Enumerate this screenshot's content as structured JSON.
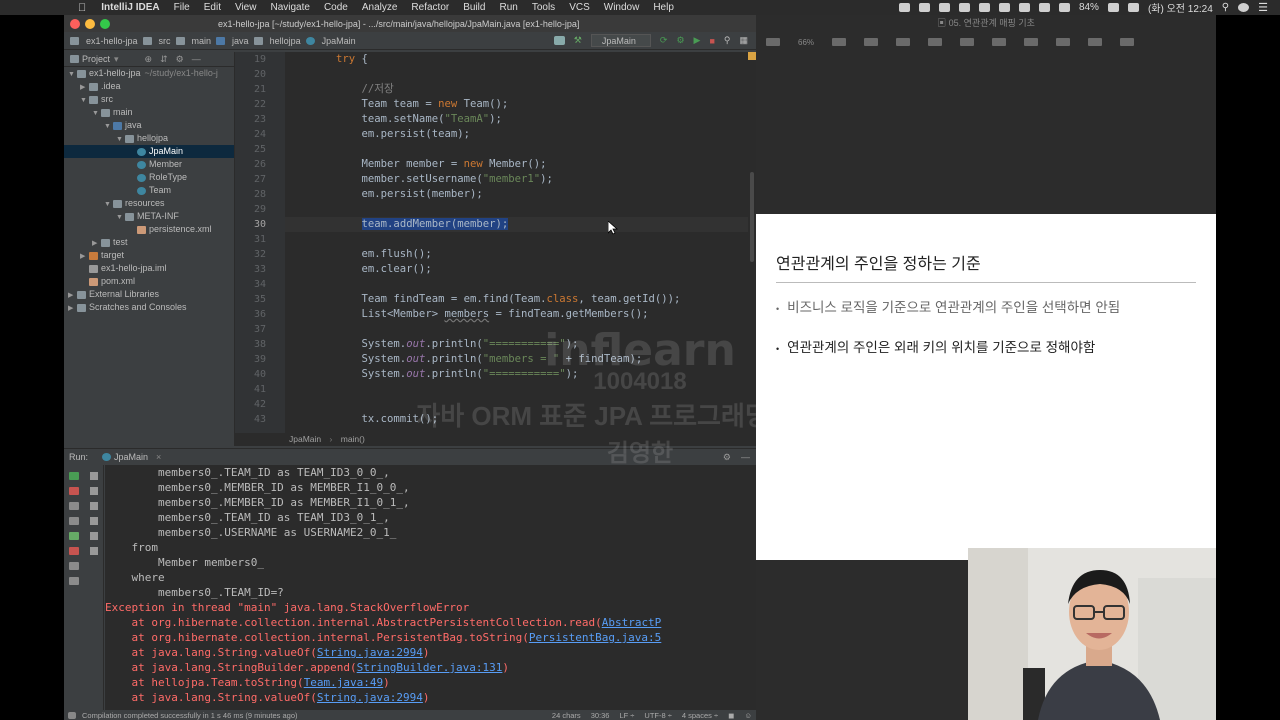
{
  "menubar": {
    "app": "IntelliJ IDEA",
    "items": [
      "File",
      "Edit",
      "View",
      "Navigate",
      "Code",
      "Analyze",
      "Refactor",
      "Build",
      "Run",
      "Tools",
      "VCS",
      "Window",
      "Help"
    ],
    "battery": "84%",
    "datetime": "(화) 오전 12:24"
  },
  "ide": {
    "window_title": "ex1-hello-jpa [~/study/ex1-hello-jpa] - .../src/main/java/hellojpa/JpaMain.java [ex1-hello-jpa]",
    "breadcrumbs": [
      "ex1-hello-jpa",
      "src",
      "main",
      "java",
      "hellojpa",
      "JpaMain"
    ],
    "run_config": "JpaMain",
    "project_panel": {
      "header": "Project",
      "tree": [
        {
          "label": "ex1-hello-jpa",
          "suffix": "~/study/ex1-hello-j",
          "depth": 0,
          "arrow": "▼",
          "icon": "folder"
        },
        {
          "label": ".idea",
          "depth": 1,
          "arrow": "▶",
          "icon": "folder"
        },
        {
          "label": "src",
          "depth": 1,
          "arrow": "▼",
          "icon": "folder"
        },
        {
          "label": "main",
          "depth": 2,
          "arrow": "▼",
          "icon": "folder"
        },
        {
          "label": "java",
          "depth": 3,
          "arrow": "▼",
          "icon": "src"
        },
        {
          "label": "hellojpa",
          "depth": 4,
          "arrow": "▼",
          "icon": "folder"
        },
        {
          "label": "JpaMain",
          "depth": 5,
          "arrow": "",
          "icon": "cls",
          "selected": true
        },
        {
          "label": "Member",
          "depth": 5,
          "arrow": "",
          "icon": "cls"
        },
        {
          "label": "RoleType",
          "depth": 5,
          "arrow": "",
          "icon": "cls"
        },
        {
          "label": "Team",
          "depth": 5,
          "arrow": "",
          "icon": "cls"
        },
        {
          "label": "resources",
          "depth": 3,
          "arrow": "▼",
          "icon": "folder"
        },
        {
          "label": "META-INF",
          "depth": 4,
          "arrow": "▼",
          "icon": "folder"
        },
        {
          "label": "persistence.xml",
          "depth": 5,
          "arrow": "",
          "icon": "xml"
        },
        {
          "label": "test",
          "depth": 2,
          "arrow": "▶",
          "icon": "folder"
        },
        {
          "label": "target",
          "depth": 1,
          "arrow": "▶",
          "icon": "orange"
        },
        {
          "label": "ex1-hello-jpa.iml",
          "depth": 1,
          "arrow": "",
          "icon": "file"
        },
        {
          "label": "pom.xml",
          "depth": 1,
          "arrow": "",
          "icon": "xml"
        },
        {
          "label": "External Libraries",
          "depth": 0,
          "arrow": "▶",
          "icon": "folder"
        },
        {
          "label": "Scratches and Consoles",
          "depth": 0,
          "arrow": "▶",
          "icon": "folder"
        }
      ]
    },
    "editor": {
      "line_numbers": [
        "19",
        "20",
        "21",
        "22",
        "23",
        "24",
        "25",
        "26",
        "27",
        "28",
        "29",
        "30",
        "31",
        "32",
        "33",
        "34",
        "35",
        "36",
        "37",
        "38",
        "39",
        "40",
        "41",
        "42",
        "43"
      ],
      "lines": [
        [
          {
            "t": "        "
          },
          {
            "t": "try",
            "c": "kw"
          },
          {
            "t": " {"
          }
        ],
        [
          {
            "t": ""
          }
        ],
        [
          {
            "t": "            "
          },
          {
            "t": "//저장",
            "c": "cmt"
          }
        ],
        [
          {
            "t": "            Team team = "
          },
          {
            "t": "new",
            "c": "kw"
          },
          {
            "t": " Team();"
          }
        ],
        [
          {
            "t": "            team.setName("
          },
          {
            "t": "\"TeamA\"",
            "c": "str"
          },
          {
            "t": ");"
          }
        ],
        [
          {
            "t": "            em.persist(team);"
          }
        ],
        [
          {
            "t": ""
          }
        ],
        [
          {
            "t": "            Member member = "
          },
          {
            "t": "new",
            "c": "kw"
          },
          {
            "t": " Member();"
          }
        ],
        [
          {
            "t": "            member.setUsername("
          },
          {
            "t": "\"member1\"",
            "c": "str"
          },
          {
            "t": ");"
          }
        ],
        [
          {
            "t": "            em.persist(member);"
          }
        ],
        [
          {
            "t": ""
          }
        ],
        [
          {
            "t": "            "
          },
          {
            "t": "team.addMember(member);",
            "c": "selection"
          }
        ],
        [
          {
            "t": ""
          }
        ],
        [
          {
            "t": "            em.flush();"
          }
        ],
        [
          {
            "t": "            em.clear();"
          }
        ],
        [
          {
            "t": ""
          }
        ],
        [
          {
            "t": "            Team findTeam = em.find(Team."
          },
          {
            "t": "class",
            "c": "kw"
          },
          {
            "t": ", team.getId());"
          }
        ],
        [
          {
            "t": "            List<Member> "
          },
          {
            "t": "members",
            "c": "ul"
          },
          {
            "t": " = findTeam.getMembers();"
          }
        ],
        [
          {
            "t": ""
          }
        ],
        [
          {
            "t": "            System."
          },
          {
            "t": "out",
            "c": "fld"
          },
          {
            "t": ".println("
          },
          {
            "t": "\"===========\"",
            "c": "str"
          },
          {
            "t": ");"
          }
        ],
        [
          {
            "t": "            System."
          },
          {
            "t": "out",
            "c": "fld"
          },
          {
            "t": ".println("
          },
          {
            "t": "\"members = \"",
            "c": "str"
          },
          {
            "t": " + findTeam);"
          }
        ],
        [
          {
            "t": "            System."
          },
          {
            "t": "out",
            "c": "fld"
          },
          {
            "t": ".println("
          },
          {
            "t": "\"===========\"",
            "c": "str"
          },
          {
            "t": ");"
          }
        ],
        [
          {
            "t": ""
          }
        ],
        [
          {
            "t": ""
          }
        ],
        [
          {
            "t": "            tx.commit();"
          }
        ]
      ],
      "breadcrumb_class": "JpaMain",
      "breadcrumb_method": "main()"
    },
    "run_panel": {
      "label": "Run:",
      "tab": "JpaMain",
      "console": [
        {
          "t": "        members0_.TEAM_ID as TEAM_ID3_0_0_,",
          "c": ""
        },
        {
          "t": "        members0_.MEMBER_ID as MEMBER_I1_0_0_,",
          "c": ""
        },
        {
          "t": "        members0_.MEMBER_ID as MEMBER_I1_0_1_,",
          "c": ""
        },
        {
          "t": "        members0_.TEAM_ID as TEAM_ID3_0_1_,",
          "c": ""
        },
        {
          "t": "        members0_.USERNAME as USERNAME2_0_1_",
          "c": ""
        },
        {
          "t": "    from",
          "c": ""
        },
        {
          "t": "        Member members0_",
          "c": ""
        },
        {
          "t": "    where",
          "c": ""
        },
        {
          "t": "        members0_.TEAM_ID=?",
          "c": ""
        },
        {
          "t": "Exception in thread \"main\" java.lang.StackOverflowError",
          "c": "err"
        },
        {
          "t": "    at org.hibernate.collection.internal.AbstractPersistentCollection.read(",
          "c": "err",
          "link": "AbstractP"
        },
        {
          "t": "    at org.hibernate.collection.internal.PersistentBag.toString(",
          "c": "err",
          "link": "PersistentBag.java:5"
        },
        {
          "t": "    at java.lang.String.valueOf(",
          "c": "err",
          "link": "String.java:2994",
          "tail": ")"
        },
        {
          "t": "    at java.lang.StringBuilder.append(",
          "c": "err",
          "link": "StringBuilder.java:131",
          "tail": ")"
        },
        {
          "t": "    at hellojpa.Team.toString(",
          "c": "err",
          "link": "Team.java:49",
          "tail": ")"
        },
        {
          "t": "    at java.lang.String.valueOf(",
          "c": "err",
          "link": "String.java:2994",
          "tail": ")"
        }
      ]
    },
    "status": {
      "message": "Compilation completed successfully in 1 s 46 ms (9 minutes ago)",
      "chars": "24 chars",
      "position": "30:36",
      "line_sep": "LF ÷",
      "encoding": "UTF-8 ÷",
      "indent": "4 spaces ÷"
    }
  },
  "keynote": {
    "window_title": "05. 연관관계 매핑 기초",
    "zoom": "66%",
    "slide": {
      "title": "연관관계의 주인을 정하는 기준",
      "bullets": [
        "비즈니스 로직을 기준으로 연관관계의 주인을 선택하면 안됨",
        "연관관계의 주인은 외래 키의 위치를 기준으로 정해야함"
      ]
    }
  },
  "watermark": {
    "brand": "inflearn",
    "id": "1004018",
    "course": "자바 ORM 표준 JPA 프로그래밍 - 기본편",
    "author": "김영한"
  }
}
